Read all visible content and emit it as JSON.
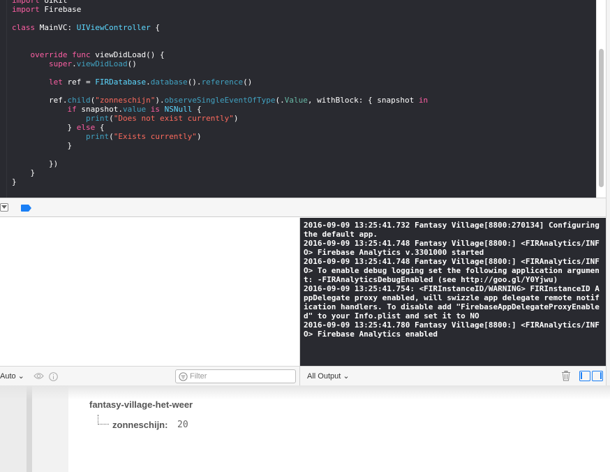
{
  "editor": {
    "lines": [
      [
        {
          "c": "k",
          "t": "import"
        },
        {
          "c": "p",
          "t": " UIKit"
        }
      ],
      [
        {
          "c": "k",
          "t": "import"
        },
        {
          "c": "p",
          "t": " Firebase"
        }
      ],
      [],
      [
        {
          "c": "k",
          "t": "class"
        },
        {
          "c": "p",
          "t": " MainVC: "
        },
        {
          "c": "t",
          "t": "UIViewController"
        },
        {
          "c": "p",
          "t": " {"
        }
      ],
      [],
      [],
      [
        {
          "c": "p",
          "t": "    "
        },
        {
          "c": "k",
          "t": "override"
        },
        {
          "c": "p",
          "t": " "
        },
        {
          "c": "k",
          "t": "func"
        },
        {
          "c": "p",
          "t": " viewDidLoad() {"
        }
      ],
      [
        {
          "c": "p",
          "t": "        "
        },
        {
          "c": "k",
          "t": "super"
        },
        {
          "c": "p",
          "t": "."
        },
        {
          "c": "f",
          "t": "viewDidLoad"
        },
        {
          "c": "p",
          "t": "()"
        }
      ],
      [],
      [
        {
          "c": "p",
          "t": "        "
        },
        {
          "c": "k",
          "t": "let"
        },
        {
          "c": "p",
          "t": " ref = "
        },
        {
          "c": "t",
          "t": "FIRDatabase"
        },
        {
          "c": "p",
          "t": "."
        },
        {
          "c": "f",
          "t": "database"
        },
        {
          "c": "p",
          "t": "()."
        },
        {
          "c": "f",
          "t": "reference"
        },
        {
          "c": "p",
          "t": "()"
        }
      ],
      [],
      [
        {
          "c": "p",
          "t": "        ref."
        },
        {
          "c": "f",
          "t": "child"
        },
        {
          "c": "p",
          "t": "("
        },
        {
          "c": "s",
          "t": "\"zonneschijn\""
        },
        {
          "c": "p",
          "t": ")."
        },
        {
          "c": "f",
          "t": "observeSingleEventOfType"
        },
        {
          "c": "p",
          "t": "(."
        },
        {
          "c": "c",
          "t": "Value"
        },
        {
          "c": "p",
          "t": ", withBlock: { snapshot "
        },
        {
          "c": "k",
          "t": "in"
        }
      ],
      [
        {
          "c": "p",
          "t": "            "
        },
        {
          "c": "k",
          "t": "if"
        },
        {
          "c": "p",
          "t": " snapshot."
        },
        {
          "c": "f",
          "t": "value"
        },
        {
          "c": "p",
          "t": " "
        },
        {
          "c": "k",
          "t": "is"
        },
        {
          "c": "p",
          "t": " "
        },
        {
          "c": "t",
          "t": "NSNull"
        },
        {
          "c": "p",
          "t": " {"
        }
      ],
      [
        {
          "c": "p",
          "t": "                "
        },
        {
          "c": "f",
          "t": "print"
        },
        {
          "c": "p",
          "t": "("
        },
        {
          "c": "s",
          "t": "\"Does not exist currently\""
        },
        {
          "c": "p",
          "t": ")"
        }
      ],
      [
        {
          "c": "p",
          "t": "            } "
        },
        {
          "c": "k",
          "t": "else"
        },
        {
          "c": "p",
          "t": " {"
        }
      ],
      [
        {
          "c": "p",
          "t": "                "
        },
        {
          "c": "f",
          "t": "print"
        },
        {
          "c": "p",
          "t": "("
        },
        {
          "c": "s",
          "t": "\"Exists currently\""
        },
        {
          "c": "p",
          "t": ")"
        }
      ],
      [
        {
          "c": "p",
          "t": "            }"
        }
      ],
      [],
      [
        {
          "c": "p",
          "t": "        })"
        }
      ],
      [
        {
          "c": "p",
          "t": "    }"
        }
      ],
      [
        {
          "c": "p",
          "t": "}"
        }
      ]
    ]
  },
  "console": {
    "log": [
      "2016-09-09 13:25:41.732 Fantasy Village[8800:270134] Configuring the default app.",
      "2016-09-09 13:25:41.748 Fantasy Village[8800:] <FIRAnalytics/INFO> Firebase Analytics v.3301000 started",
      "2016-09-09 13:25:41.748 Fantasy Village[8800:] <FIRAnalytics/INFO> To enable debug logging set the following application argument: -FIRAnalyticsDebugEnabled (see http://goo.gl/Y0Yjwu)",
      "2016-09-09 13:25:41.754: <FIRInstanceID/WARNING> FIRInstanceID AppDelegate proxy enabled, will swizzle app delegate remote notification handlers. To disable add \"FirebaseAppDelegateProxyEnabled\" to your Info.plist and set it to NO",
      "2016-09-09 13:25:41.780 Fantasy Village[8800:] <FIRAnalytics/INFO> Firebase Analytics enabled"
    ]
  },
  "variables_bar": {
    "scope_label": "Auto ⌄",
    "filter_placeholder": "Filter"
  },
  "console_bar": {
    "output_label": "All Output ⌄"
  },
  "firebase": {
    "root_key": "fantasy-village-het-weer",
    "child_key": "zonneschijn:",
    "child_value": "20"
  },
  "colors": {
    "editor_bg": "#292a30",
    "keyword": "#fc5fa3",
    "type": "#5dd8ff",
    "string": "#fc6a5d",
    "accent": "#1a7ff5"
  }
}
